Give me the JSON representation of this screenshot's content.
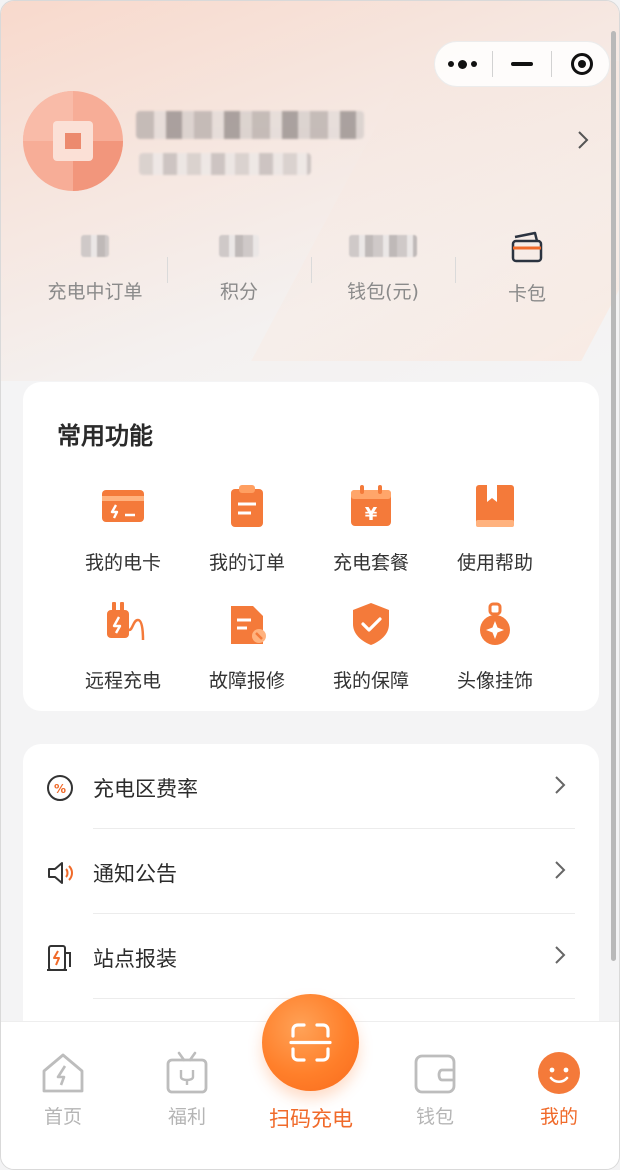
{
  "stats": [
    {
      "label": "充电中订单"
    },
    {
      "label": "积分"
    },
    {
      "label": "钱包(元)"
    },
    {
      "label": "卡包"
    }
  ],
  "functions": {
    "title": "常用功能",
    "items": [
      {
        "label": "我的电卡",
        "icon": "battery-card-icon"
      },
      {
        "label": "我的订单",
        "icon": "clipboard-icon"
      },
      {
        "label": "充电套餐",
        "icon": "calendar-yuan-icon"
      },
      {
        "label": "使用帮助",
        "icon": "bookmark-book-icon"
      },
      {
        "label": "远程充电",
        "icon": "plug-icon"
      },
      {
        "label": "故障报修",
        "icon": "wrench-document-icon"
      },
      {
        "label": "我的保障",
        "icon": "shield-check-icon"
      },
      {
        "label": "头像挂饰",
        "icon": "pendant-icon"
      }
    ]
  },
  "menu": [
    {
      "label": "充电区费率",
      "icon": "percent-icon"
    },
    {
      "label": "通知公告",
      "icon": "speaker-icon"
    },
    {
      "label": "站点报装",
      "icon": "charging-station-icon"
    }
  ],
  "tabbar": {
    "home": "首页",
    "welfare": "福利",
    "scan": "扫码充电",
    "wallet": "钱包",
    "mine": "我的"
  },
  "colors": {
    "accent": "#f06a2a",
    "icon_orange": "#f47a3a",
    "inactive": "#b5b5b5"
  }
}
